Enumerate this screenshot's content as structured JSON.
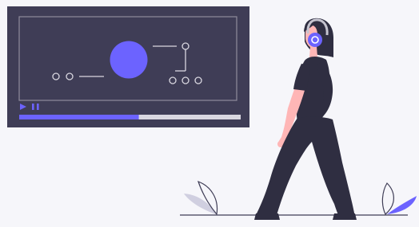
{
  "player": {
    "progress": 0.54,
    "controls": [
      "play-icon",
      "pause-icon"
    ],
    "colors": {
      "screen": "#3f3d56",
      "screen_frame_line": "#8f8c9c",
      "diagram_line": "#d9d7e0",
      "accent": "#6c63ff",
      "track": "#d9d7e0"
    }
  },
  "figure": {
    "headphones_icon": "headphones-icon",
    "colors": {
      "hair": "#2f2e41",
      "skin": "#ffb6b6",
      "clothing": "#2f2e41",
      "headphones": "#6c63ff",
      "headphone_band": "#c5c4cf"
    }
  },
  "ground": {
    "colors": {
      "line": "#3f3d56",
      "leaf_grey": "#d0cfe0",
      "leaf_accent": "#6c63ff"
    }
  }
}
